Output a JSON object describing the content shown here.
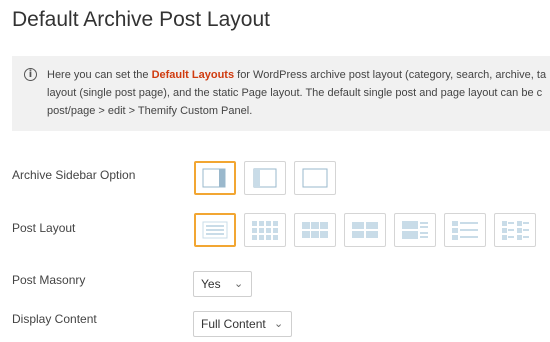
{
  "page": {
    "title": "Default Archive Post Layout"
  },
  "notice": {
    "icon": "info-icon",
    "line1_pre": "Here you can set the ",
    "line1_link": "Default Layouts",
    "line1_post": " for WordPress archive post layout (category, search, archive, ta",
    "line2": "layout (single post page), and the static Page layout. The default single post and page layout can be c",
    "line3": "post/page > edit > Themify Custom Panel."
  },
  "archive_sidebar": {
    "label": "Archive Sidebar Option",
    "options": [
      "sidebar-right-icon",
      "sidebar-left-icon",
      "no-sidebar-icon"
    ],
    "selected_index": 0
  },
  "post_layout": {
    "label": "Post Layout",
    "options": [
      "list-post-icon",
      "grid4-icon",
      "grid3-icon",
      "grid2-icon",
      "list-large-image-icon",
      "list-thumb-image-icon",
      "grid2-thumb-icon"
    ],
    "selected_index": 0
  },
  "post_masonry": {
    "label": "Post Masonry",
    "value": "Yes"
  },
  "display_content": {
    "label": "Display Content",
    "value": "Full Content"
  },
  "colors": {
    "accent": "#f2a632",
    "link": "#d03b0f",
    "icon_fill": "#c9dce8",
    "icon_dark": "#9ab8cc"
  }
}
